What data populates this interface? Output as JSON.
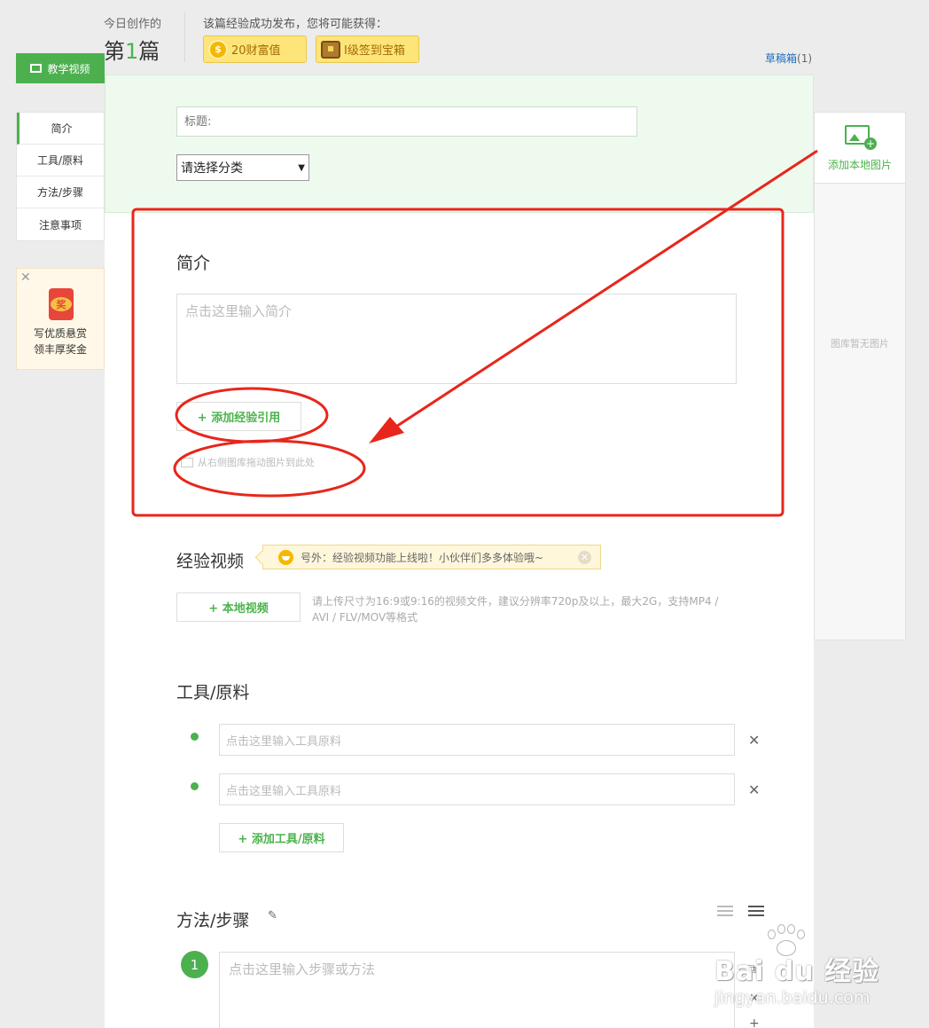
{
  "header": {
    "created_label": "今日创作的",
    "count_prefix": "第",
    "count_number": "1",
    "count_suffix": "篇",
    "reward_tip": "该篇经验成功发布，您将可能获得：",
    "reward_wealth": "20财富值",
    "reward_chest": "I级签到宝箱",
    "drafts_label": "草稿箱",
    "drafts_count": "(1)"
  },
  "sidebar": {
    "video_button": "教学视频",
    "nav": [
      {
        "label": "简介"
      },
      {
        "label": "工具/原料"
      },
      {
        "label": "方法/步骤"
      },
      {
        "label": "注意事项"
      }
    ],
    "promo": {
      "seal": "奖",
      "line1": "写优质悬赏",
      "line2": "领丰厚奖金"
    }
  },
  "form": {
    "title_placeholder": "标题:",
    "category_value": "请选择分类",
    "intro": {
      "heading": "简介",
      "placeholder": "点击这里输入简介",
      "add_ref": "+ 添加经验引用",
      "drag_hint": "从右侧图库拖动图片到此处"
    },
    "video": {
      "heading": "经验视频",
      "notice": "号外：经验视频功能上线啦！小伙伴们多多体验哦~",
      "local_button": "+ 本地视频",
      "help": "请上传尺寸为16:9或9:16的视频文件，建议分辨率720p及以上，最大2G，支持MP4 / AVI / FLV/MOV等格式"
    },
    "tools": {
      "heading": "工具/原料",
      "items": [
        {
          "placeholder": "点击这里输入工具原料"
        },
        {
          "placeholder": "点击这里输入工具原料"
        }
      ],
      "add_button": "+ 添加工具/原料"
    },
    "steps": {
      "heading": "方法/步骤",
      "step_number": "1",
      "placeholder": "点击这里输入步骤或方法"
    }
  },
  "gallery": {
    "add_label": "添加本地图片",
    "empty_text": "图库暂无图片"
  },
  "watermark": {
    "brand": "Bai du 经验",
    "url": "jingyan.baidu.com"
  },
  "colors": {
    "accent": "#4cb04f",
    "annotation": "#e8261b",
    "link": "#1f6ebf"
  }
}
